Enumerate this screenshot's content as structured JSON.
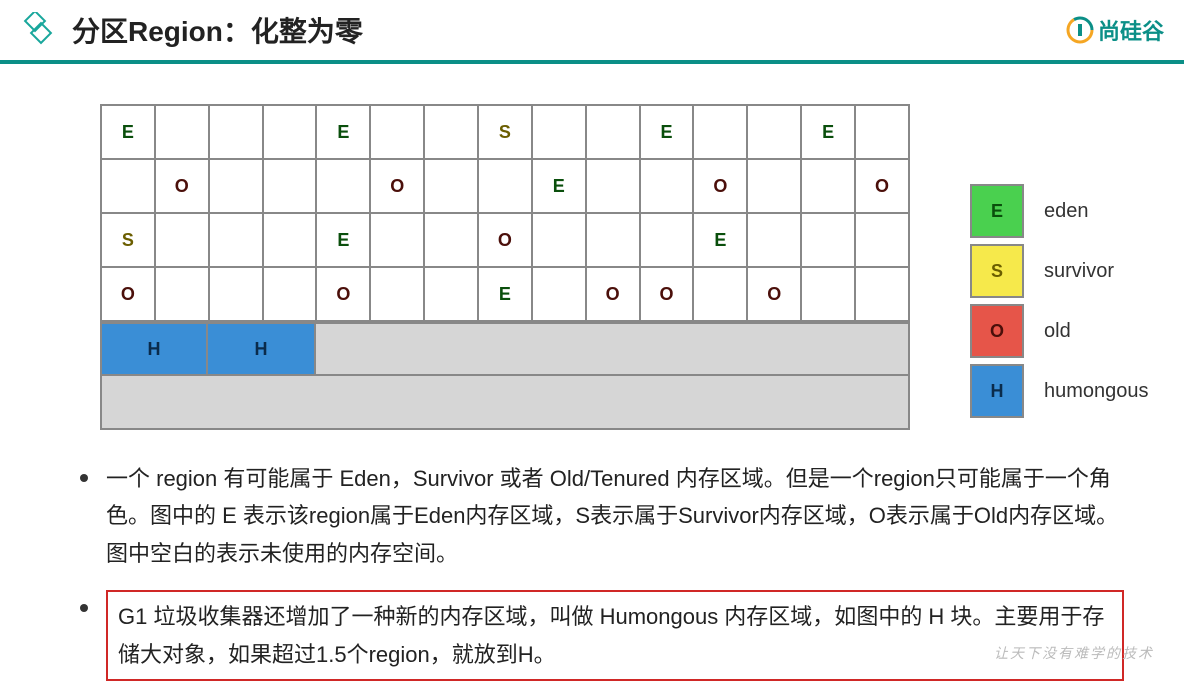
{
  "header": {
    "title": "分区Region：化整为零",
    "brand": "尚硅谷"
  },
  "grid": {
    "rows": [
      [
        "E",
        "",
        "",
        "",
        "E",
        "",
        "",
        "S",
        "",
        "",
        "E",
        "",
        "",
        "E",
        ""
      ],
      [
        "",
        "O",
        "",
        "",
        "",
        "O",
        "",
        "",
        "E",
        "",
        "",
        "O",
        "",
        "",
        "O"
      ],
      [
        "S",
        "",
        "",
        "",
        "E",
        "",
        "",
        "O",
        "",
        "",
        "",
        "E",
        "",
        "",
        ""
      ],
      [
        "O",
        "",
        "",
        "",
        "O",
        "",
        "",
        "E",
        "",
        "O",
        "O",
        "",
        "O",
        "",
        ""
      ]
    ],
    "h_row_cells": [
      "H",
      "H"
    ],
    "h_cell_span": 2
  },
  "legend": [
    {
      "key": "E",
      "class": "E",
      "label": "eden"
    },
    {
      "key": "S",
      "class": "S",
      "label": "survivor"
    },
    {
      "key": "O",
      "class": "O",
      "label": "old"
    },
    {
      "key": "H",
      "class": "H",
      "label": "humongous"
    }
  ],
  "bullets": [
    {
      "highlight": false,
      "text": "一个 region 有可能属于 Eden，Survivor 或者 Old/Tenured 内存区域。但是一个region只可能属于一个角色。图中的 E 表示该region属于Eden内存区域，S表示属于Survivor内存区域，O表示属于Old内存区域。图中空白的表示未使用的内存空间。"
    },
    {
      "highlight": true,
      "text": "G1 垃圾收集器还增加了一种新的内存区域，叫做 Humongous 内存区域，如图中的 H 块。主要用于存储大对象，如果超过1.5个region，就放到H。"
    }
  ],
  "watermark": "让天下没有难学的技术"
}
